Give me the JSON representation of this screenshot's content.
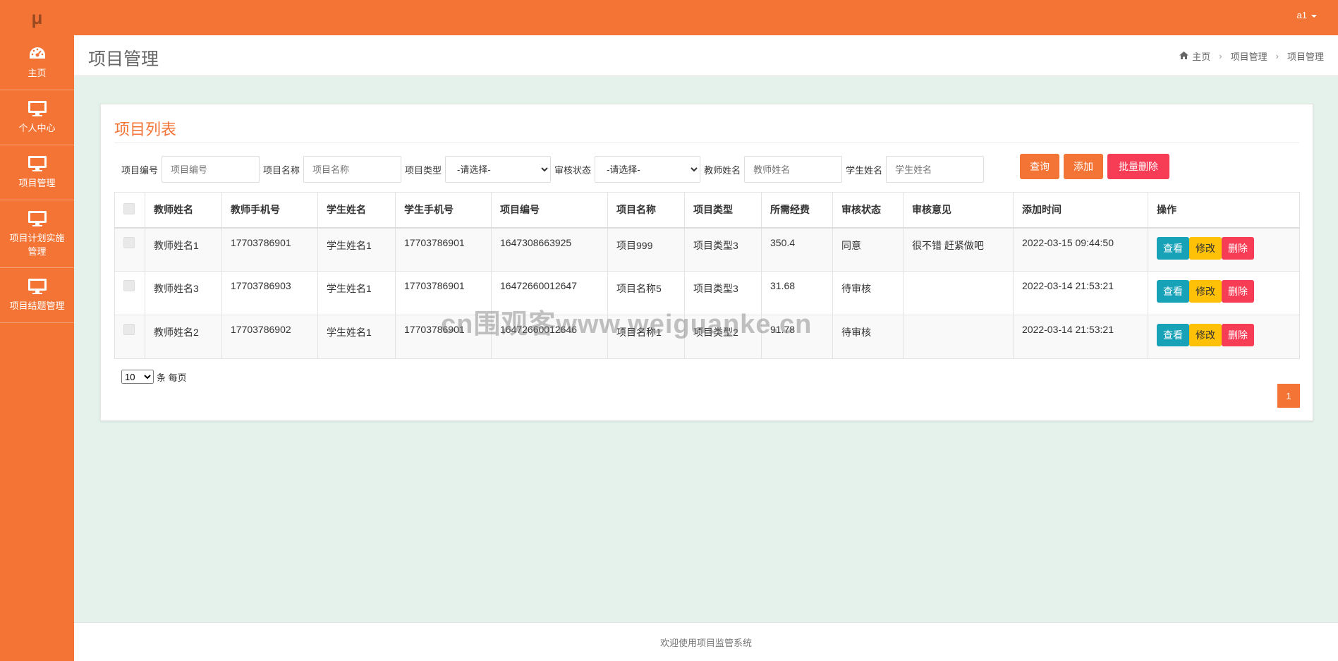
{
  "app": {
    "logo": "μ",
    "user": "a1"
  },
  "sidebar": {
    "items": [
      {
        "label": "主页",
        "icon": "dashboard-icon"
      },
      {
        "label": "个人中心",
        "icon": "monitor-icon"
      },
      {
        "label": "项目管理",
        "icon": "monitor-icon"
      },
      {
        "label": "项目计划实施管理",
        "icon": "monitor-icon"
      },
      {
        "label": "项目结题管理",
        "icon": "monitor-icon"
      }
    ]
  },
  "header": {
    "title": "项目管理",
    "breadcrumb": [
      "主页",
      "项目管理",
      "项目管理"
    ]
  },
  "panel": {
    "title": "项目列表",
    "filters": {
      "project_no_label": "项目编号",
      "project_no_placeholder": "项目编号",
      "project_name_label": "项目名称",
      "project_name_placeholder": "项目名称",
      "project_type_label": "项目类型",
      "project_type_value": "-请选择-",
      "review_status_label": "审核状态",
      "review_status_value": "-请选择-",
      "teacher_label": "教师姓名",
      "teacher_placeholder": "教师姓名",
      "student_label": "学生姓名",
      "student_placeholder": "学生姓名"
    },
    "buttons": {
      "query": "查询",
      "add": "添加",
      "batch_delete": "批量删除"
    },
    "columns": [
      "教师姓名",
      "教师手机号",
      "学生姓名",
      "学生手机号",
      "项目编号",
      "项目名称",
      "项目类型",
      "所需经费",
      "审核状态",
      "审核意见",
      "添加时间",
      "操作"
    ],
    "rows": [
      {
        "teacher": "教师姓名1",
        "teacher_phone": "17703786901",
        "student": "学生姓名1",
        "student_phone": "17703786901",
        "project_no": "1647308663925",
        "project_name": "项目999",
        "project_type": "项目类型3",
        "funds": "350.4",
        "status": "同意",
        "opinion": "很不错 赶紧做吧",
        "added": "2022-03-15 09:44:50"
      },
      {
        "teacher": "教师姓名3",
        "teacher_phone": "17703786903",
        "student": "学生姓名1",
        "student_phone": "17703786901",
        "project_no": "16472660012647",
        "project_name": "项目名称5",
        "project_type": "项目类型3",
        "funds": "31.68",
        "status": "待审核",
        "opinion": "",
        "added": "2022-03-14 21:53:21"
      },
      {
        "teacher": "教师姓名2",
        "teacher_phone": "17703786902",
        "student": "学生姓名1",
        "student_phone": "17703786901",
        "project_no": "16472660012646",
        "project_name": "项目名称1",
        "project_type": "项目类型2",
        "funds": "91.78",
        "status": "待审核",
        "opinion": "",
        "added": "2022-03-14 21:53:21"
      }
    ],
    "row_actions": {
      "view": "查看",
      "edit": "修改",
      "delete": "删除"
    },
    "page_size": {
      "value": "10",
      "suffix": "条 每页"
    },
    "current_page": "1"
  },
  "watermark": "cn围观客www.weiguanke.cn",
  "footer": "欢迎使用项目监管系统",
  "colors": {
    "accent": "#f37435",
    "danger": "#f73c55",
    "info": "#17a2b8",
    "warning": "#ffc107"
  }
}
